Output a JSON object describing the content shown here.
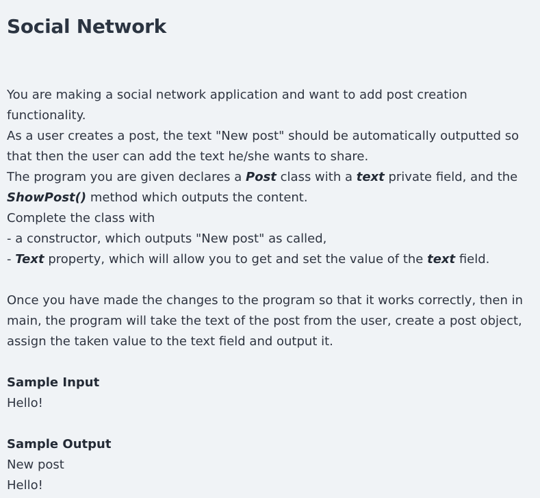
{
  "title": "Social Network",
  "description": {
    "line1": "You are making a social network application and want to add post creation",
    "line2": "functionality.",
    "line3": "As a user creates a post, the text \"New post\" should be automatically outputted so",
    "line4": "that then the user can add the text he/she wants to share.",
    "line5": {
      "a": "The program you are given declares a ",
      "b": "Post",
      "c": " class with a ",
      "d": "text",
      "e": " private field, and the"
    },
    "line6": {
      "a": "ShowPost()",
      "b": " method which outputs the content."
    },
    "line7": "Complete the class with",
    "line8": "- a constructor, which outputs \"New post\" as called,",
    "line9": {
      "a": "- ",
      "b": "Text",
      "c": " property, which will allow you to get and set the value of the ",
      "d": "text",
      "e": " field."
    }
  },
  "paragraph2": {
    "line1": "Once you have made the changes to the program so that it works correctly, then in",
    "line2": "main, the program will take the text of the post from the user, create a post object,",
    "line3": "assign the taken value to the text field and output it."
  },
  "sample_input": {
    "label": "Sample Input",
    "lines": [
      "Hello!"
    ]
  },
  "sample_output": {
    "label": "Sample Output",
    "lines": [
      "New post",
      "Hello!"
    ]
  }
}
